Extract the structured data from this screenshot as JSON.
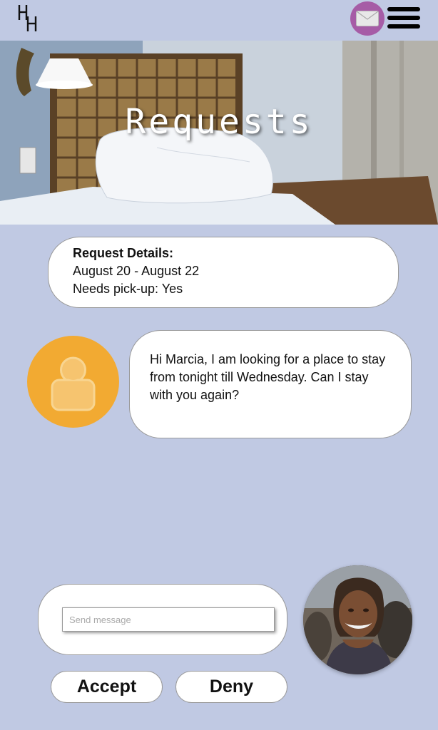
{
  "header": {
    "logo_icon": "hh-logo-icon",
    "mail_icon": "envelope-icon",
    "menu_icon": "hamburger-menu-icon",
    "mail_color": "#a65ca6"
  },
  "hero": {
    "title": "Requests"
  },
  "request_details": {
    "heading": "Request Details:",
    "dates": "August 20 - August 22",
    "pickup": "Needs pick-up: Yes"
  },
  "conversation": {
    "guest_avatar_icon": "user-placeholder-icon",
    "guest_avatar_color": "#f2aa32",
    "message": "Hi Marcia, I am looking for a place to stay from tonight till Wednesday. Can I stay with you again?"
  },
  "compose": {
    "placeholder": "Send message"
  },
  "actions": {
    "accept": "Accept",
    "deny": "Deny"
  },
  "colors": {
    "background": "#c0c9e3"
  }
}
